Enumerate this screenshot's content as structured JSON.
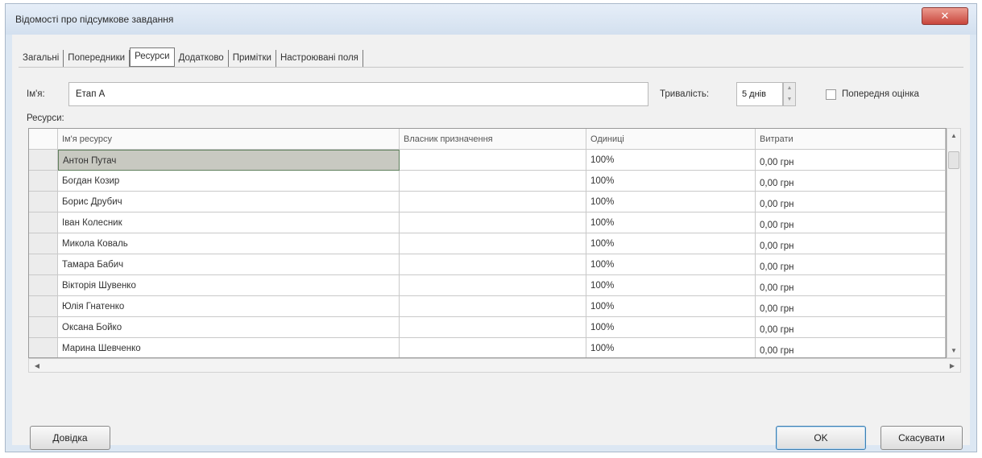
{
  "dialog": {
    "title": "Відомості про підсумкове завдання",
    "close_glyph": "✕"
  },
  "tabs": [
    {
      "label": "Загальні",
      "active": false
    },
    {
      "label": "Попередники",
      "active": false
    },
    {
      "label": "Ресурси",
      "active": true
    },
    {
      "label": "Додатково",
      "active": false
    },
    {
      "label": "Примітки",
      "active": false
    },
    {
      "label": "Настроювані поля",
      "active": false
    }
  ],
  "form": {
    "name_label": "Ім'я:",
    "name_value": "Етап А",
    "duration_label": "Тривалість:",
    "duration_value": "5 днів",
    "estimate_label": "Попередня оцінка",
    "estimate_checked": false,
    "resources_label": "Ресурси:"
  },
  "table": {
    "columns": [
      "Ім'я ресурсу",
      "Власник призначення",
      "Одиниці",
      "Витрати"
    ],
    "rows": [
      {
        "name": "Антон Путач",
        "owner": "",
        "units": "100%",
        "cost": "0,00 грн"
      },
      {
        "name": "Богдан Козир",
        "owner": "",
        "units": "100%",
        "cost": "0,00 грн"
      },
      {
        "name": "Борис Друбич",
        "owner": "",
        "units": "100%",
        "cost": "0,00 грн"
      },
      {
        "name": "Іван Колесник",
        "owner": "",
        "units": "100%",
        "cost": "0,00 грн"
      },
      {
        "name": "Микола Коваль",
        "owner": "",
        "units": "100%",
        "cost": "0,00 грн"
      },
      {
        "name": "Тамара Бабич",
        "owner": "",
        "units": "100%",
        "cost": "0,00 грн"
      },
      {
        "name": "Вікторія Шувенко",
        "owner": "",
        "units": "100%",
        "cost": "0,00 грн"
      },
      {
        "name": "Юлія Гнатенко",
        "owner": "",
        "units": "100%",
        "cost": "0,00 грн"
      },
      {
        "name": "Оксана Бойко",
        "owner": "",
        "units": "100%",
        "cost": "0,00 грн"
      },
      {
        "name": "Марина Шевченко",
        "owner": "",
        "units": "100%",
        "cost": "0,00 грн"
      }
    ],
    "selected_row": 0
  },
  "buttons": {
    "help": "Довідка",
    "ok": "OK",
    "cancel": "Скасувати"
  }
}
